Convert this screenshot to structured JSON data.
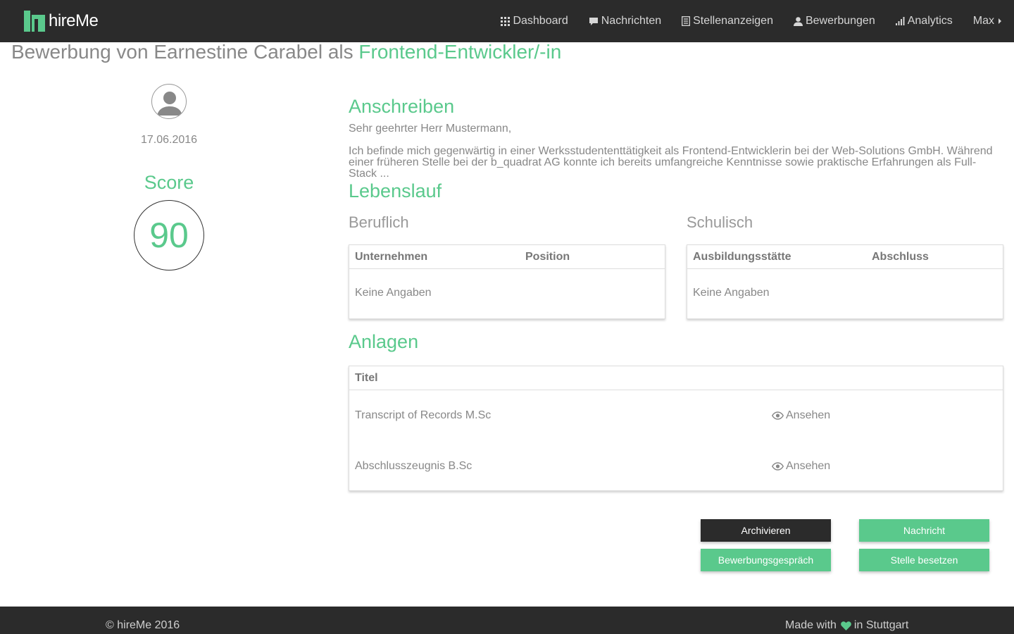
{
  "app": {
    "brand": "hireMe"
  },
  "nav": {
    "items": [
      {
        "label": "Dashboard",
        "icon": "grid-icon"
      },
      {
        "label": "Nachrichten",
        "icon": "chat-icon"
      },
      {
        "label": "Stellenanzeigen",
        "icon": "list-icon"
      },
      {
        "label": "Bewerbungen",
        "icon": "user-icon"
      },
      {
        "label": "Analytics",
        "icon": "signal-bars-icon"
      }
    ],
    "user": "Max"
  },
  "page": {
    "title_prefix": "Bewerbung von Earnestine Carabel als ",
    "title_position": "Frontend-Entwickler/-in"
  },
  "applicant": {
    "date": "17.06.2016",
    "score_label": "Score",
    "score": "90"
  },
  "cover_letter": {
    "title": "Anschreiben",
    "greeting": "Sehr geehrter Herr Mustermann,",
    "body": "Ich befinde mich gegenwärtig in einer Werksstudententtätigkeit als Frontend-Entwicklerin bei der Web-Solutions GmbH. Während einer früheren Stelle bei der b_quadrat AG konnte ich bereits umfangreiche Kenntnisse sowie praktische Erfahrungen als Full-Stack ..."
  },
  "cv": {
    "title": "Lebenslauf",
    "professional": {
      "title": "Beruflich",
      "col1": "Unternehmen",
      "col2": "Position",
      "empty": "Keine Angaben"
    },
    "education": {
      "title": "Schulisch",
      "col1": "Ausbildungsstätte",
      "col2": "Abschluss",
      "empty": "Keine Angaben"
    }
  },
  "attachments": {
    "title": "Anlagen",
    "header": "Titel",
    "view_label": "Ansehen",
    "rows": [
      {
        "title": "Transcript of Records M.Sc"
      },
      {
        "title": "Abschlusszeugnis B.Sc"
      }
    ]
  },
  "actions": {
    "archive": "Archivieren",
    "message": "Nachricht",
    "interview": "Bewerbungsgespräch",
    "fill_position": "Stelle besetzen"
  },
  "footer": {
    "copyright": "© hireMe 2016",
    "made_with": "Made with",
    "location": "in Stuttgart"
  },
  "colors": {
    "accent": "#5ac98c",
    "dark": "#2b2b2b"
  }
}
